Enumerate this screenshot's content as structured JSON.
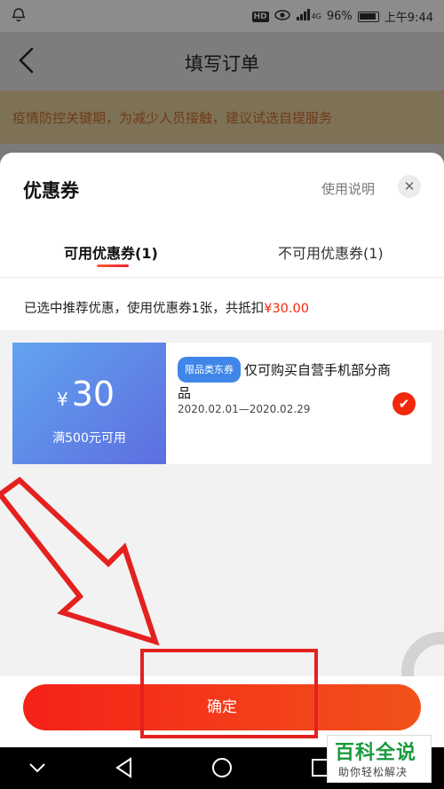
{
  "status_bar": {
    "battery": "96%",
    "time": "上午9:44",
    "network": "4G",
    "hd": "HD"
  },
  "header": {
    "title": "填写订单"
  },
  "notice": {
    "text": "疫情防控关键期，为减少人员接触，建议试选自提服务"
  },
  "sheet": {
    "title": "优惠券",
    "usage_link": "使用说明",
    "tabs": [
      {
        "label": "可用优惠券(1)",
        "active": true
      },
      {
        "label": "不可用优惠券(1)",
        "active": false
      }
    ],
    "summary_prefix": "已选中推荐优惠，使用优惠券1张，共抵扣",
    "summary_amount": "¥30.00",
    "coupon": {
      "currency": "¥",
      "value": "30",
      "threshold": "满500元可用",
      "tag": "限品类东券",
      "description": "仅可购买自营手机部分商品",
      "date_range": "2020.02.01—2020.02.29",
      "selected": true
    },
    "confirm_label": "确定"
  },
  "watermark": {
    "title": "百科全说",
    "subtitle": "助你轻松解决"
  },
  "colors": {
    "accent": "#f2270c",
    "coupon_blue": "#5d8be8",
    "annotation_red": "#e4211f"
  }
}
